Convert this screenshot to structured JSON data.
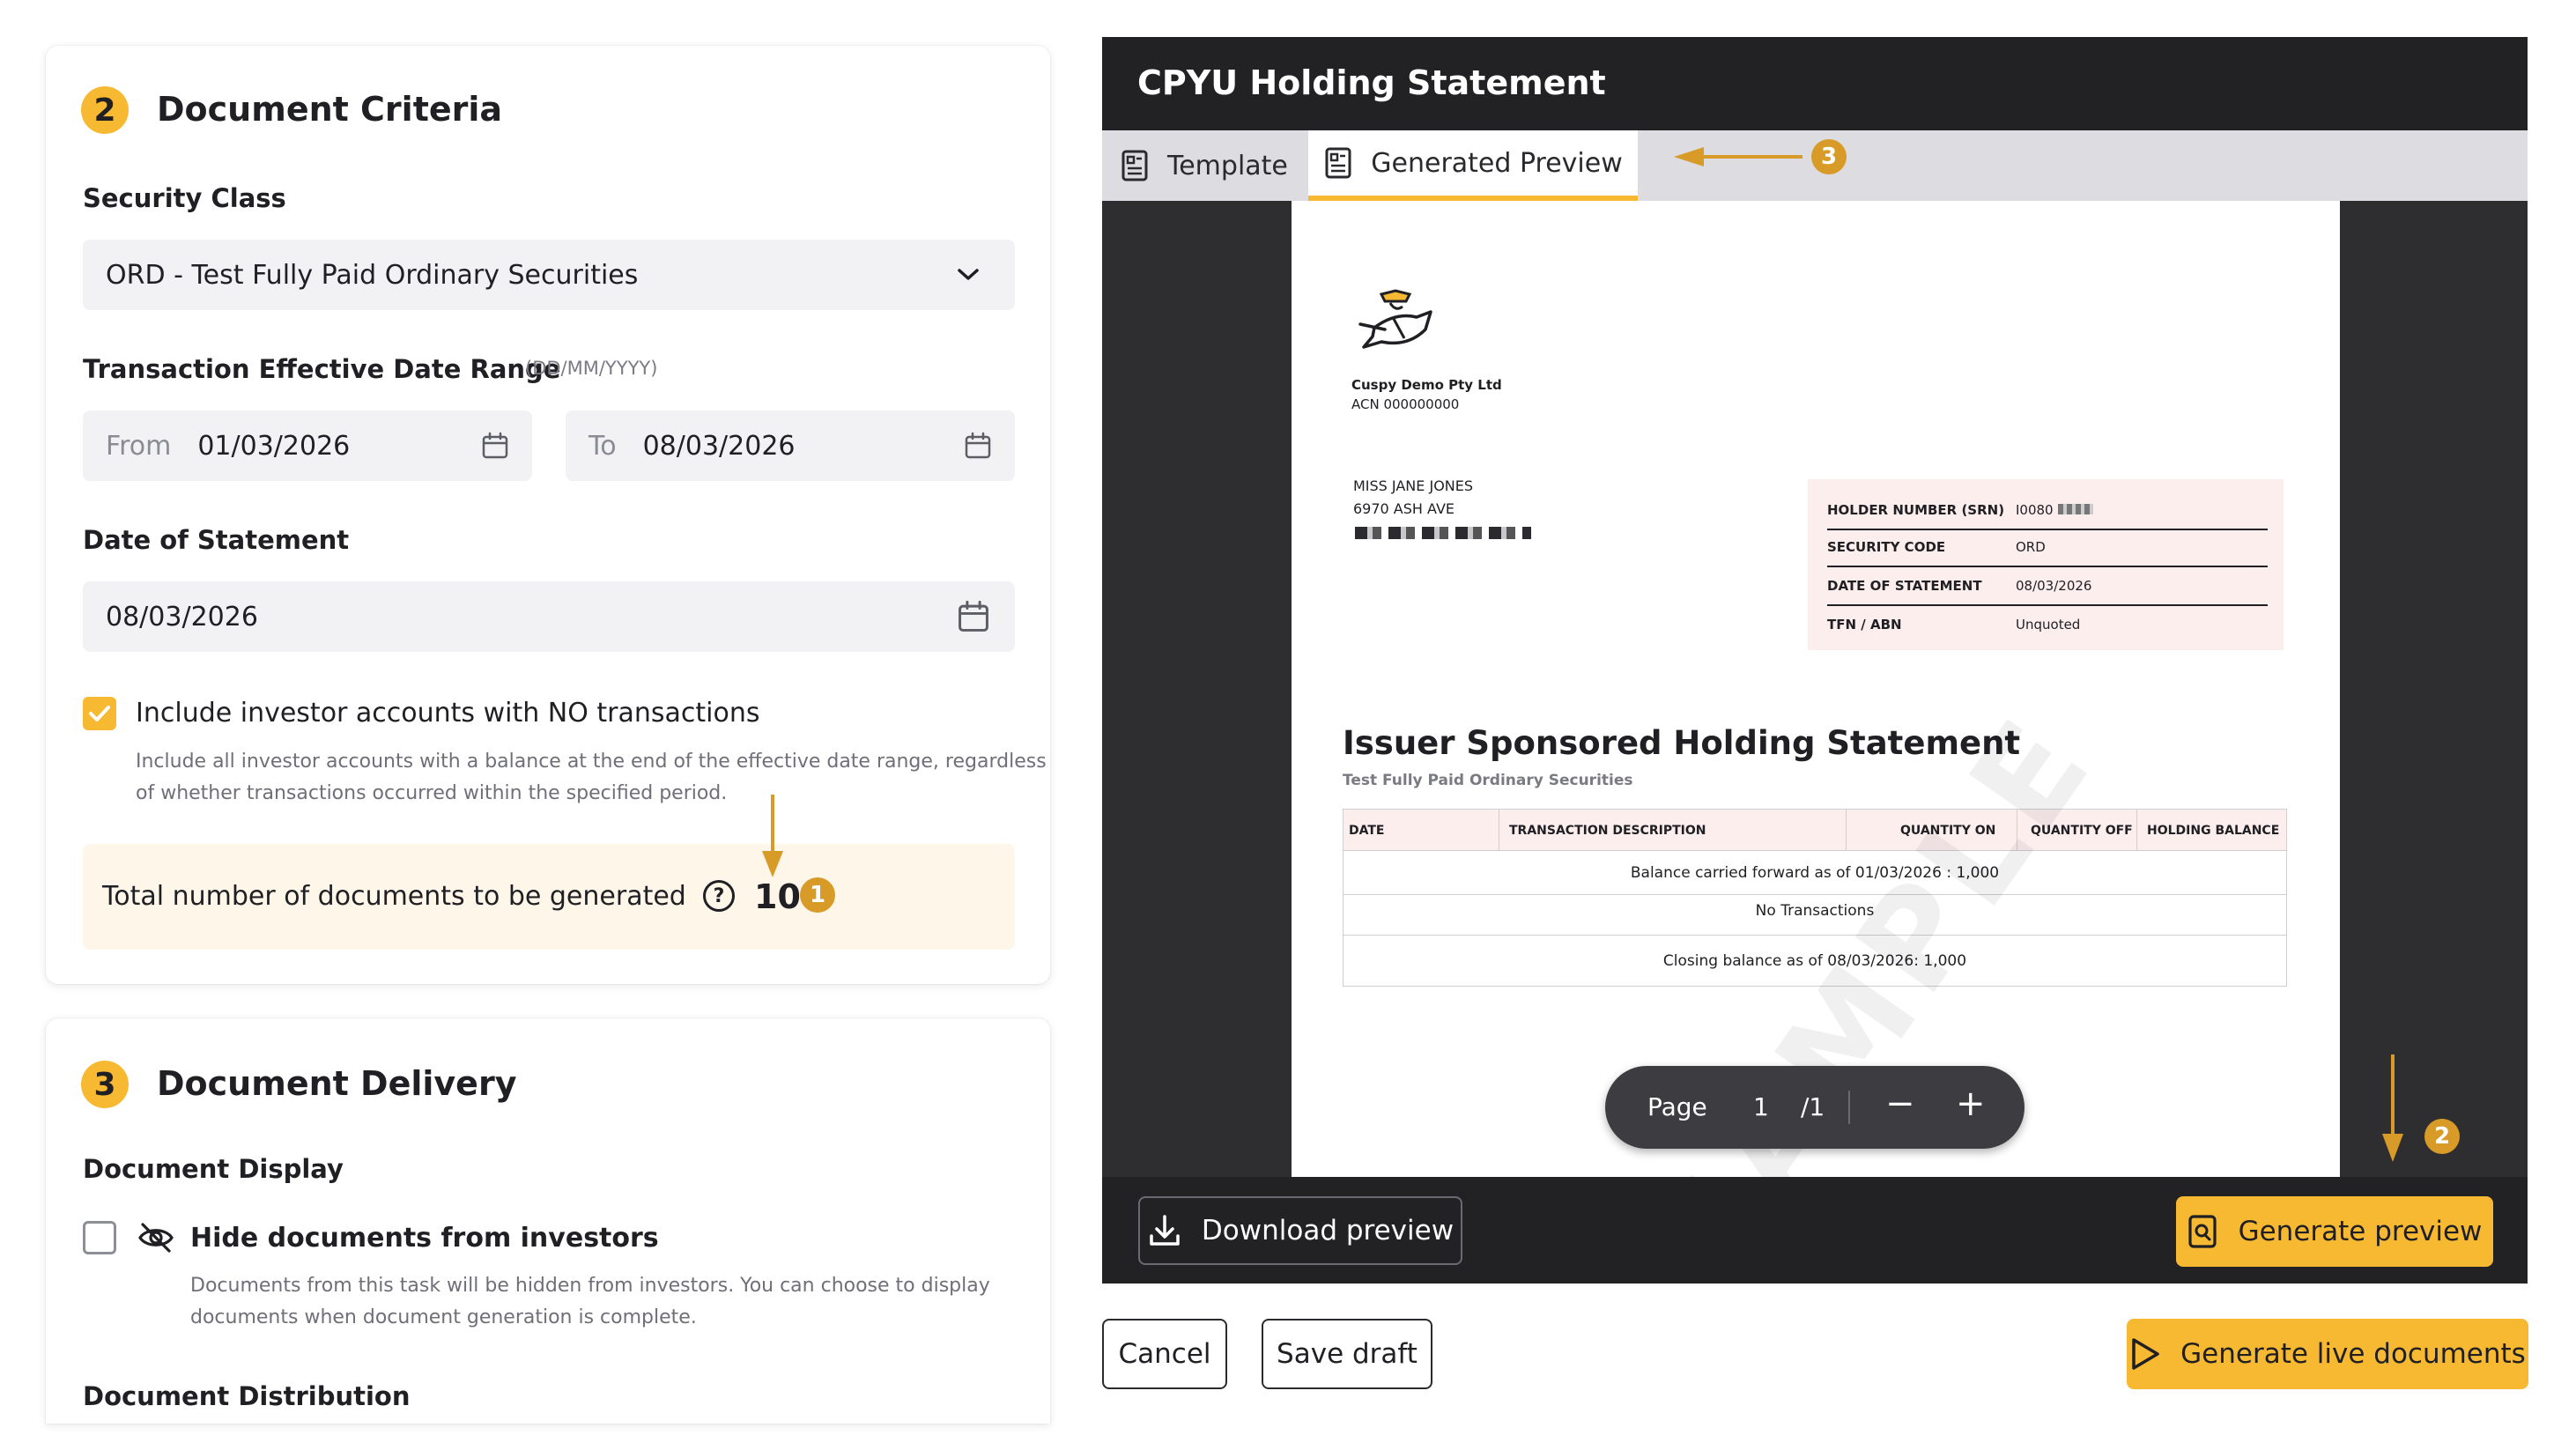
{
  "criteria": {
    "step": "2",
    "title": "Document Criteria",
    "security_class_label": "Security Class",
    "security_class_value": "ORD - Test Fully Paid Ordinary Securities",
    "date_range_label": "Transaction Effective Date Range",
    "date_format": "(DD/MM/YYYY)",
    "from_label": "From",
    "from_value": "01/03/2026",
    "to_label": "To",
    "to_value": "08/03/2026",
    "statement_date_label": "Date of Statement",
    "statement_date_value": "08/03/2026",
    "include_label": "Include investor accounts with NO transactions",
    "include_checked": true,
    "include_desc_1": "Include all investor accounts with a balance at the end of the effective date range, regardless",
    "include_desc_2": "of whether transactions occurred within the specified period.",
    "total_label": "Total number of documents to be generated",
    "total_value": "10",
    "help_icon": "?"
  },
  "delivery": {
    "step": "3",
    "title": "Document Delivery",
    "display_label": "Document Display",
    "hide_label": "Hide documents from investors",
    "hide_checked": false,
    "hide_desc_1": "Documents from this task will be hidden from investors. You can choose to display",
    "hide_desc_2": "documents when document generation is complete.",
    "distribution_label": "Document Distribution"
  },
  "panel": {
    "title": "CPYU Holding Statement",
    "tabs": [
      {
        "label": "Template",
        "active": false
      },
      {
        "label": "Generated Preview",
        "active": true
      }
    ]
  },
  "document": {
    "company": "Cuspy Demo Pty Ltd",
    "acn": "ACN 000000000",
    "addressee_1": "MISS JANE JONES",
    "addressee_2": "6970 ASH AVE",
    "info_rows": [
      {
        "k": "HOLDER NUMBER (SRN)",
        "v": "I0080"
      },
      {
        "k": "SECURITY CODE",
        "v": "ORD"
      },
      {
        "k": "DATE OF STATEMENT",
        "v": "08/03/2026"
      },
      {
        "k": "TFN / ABN",
        "v": "Unquoted"
      }
    ],
    "heading": "Issuer Sponsored Holding Statement",
    "subheading": "Test Fully Paid Ordinary Securities",
    "table_headers": [
      "DATE",
      "TRANSACTION DESCRIPTION",
      "QUANTITY ON",
      "QUANTITY OFF",
      "HOLDING BALANCE"
    ],
    "table_rows": [
      "Balance carried forward as of 01/03/2026 : 1,000",
      "No Transactions",
      "Closing balance as of 08/03/2026: 1,000"
    ],
    "watermark": "SAMPLE"
  },
  "pager": {
    "page_label": "Page",
    "current": "1",
    "total": "/1",
    "minus": "−",
    "plus": "+"
  },
  "actions": {
    "download_preview": "Download preview",
    "generate_preview": "Generate preview",
    "cancel": "Cancel",
    "save_draft": "Save draft",
    "generate_live": "Generate live documents"
  },
  "annotations": {
    "one": "1",
    "two": "2",
    "three": "3"
  },
  "colors": {
    "accent": "#f7b932",
    "annotation": "#d99b27",
    "panel": "#2e2e31"
  }
}
